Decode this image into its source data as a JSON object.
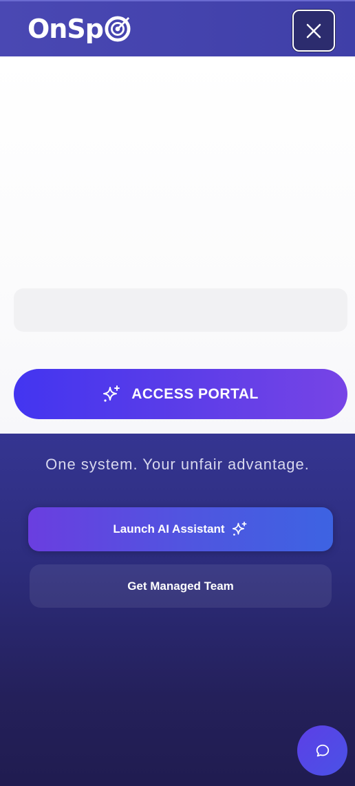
{
  "header": {
    "logo_text": "OnSp",
    "logo_icon": "target-icon",
    "close_icon": "close-icon"
  },
  "main": {
    "access_button": {
      "label": "ACCESS PORTAL",
      "icon": "sparkle-icon"
    },
    "tagline": "One system. Your unfair advantage.",
    "launch_button": {
      "label": "Launch AI Assistant",
      "icon": "sparkle-icon"
    },
    "managed_button": {
      "label": "Get Managed Team"
    },
    "chat_button": {
      "icon": "chat-bubble-icon"
    }
  },
  "colors": {
    "header_bg": "#4a48b3",
    "accent_start": "#4335f0",
    "accent_end": "#7744e6",
    "dark_bg": "#2d2d7e"
  }
}
